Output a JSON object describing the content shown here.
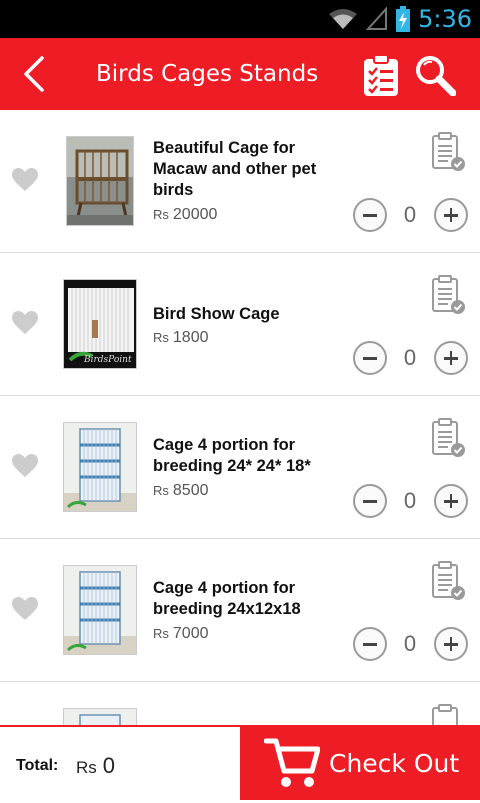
{
  "status_bar": {
    "time": "5:36",
    "icons": [
      "wifi-icon",
      "signal-icon",
      "battery-icon"
    ]
  },
  "app_bar": {
    "title": "Birds Cages Stands",
    "back_icon": "back-arrow-icon",
    "list_icon": "clipboard-list-icon",
    "search_icon": "search-icon"
  },
  "currency_symbol": "Rs",
  "products": [
    {
      "name": "Beautiful Cage for Macaw and other pet birds",
      "price": "20000",
      "qty": "0"
    },
    {
      "name": "Bird Show Cage",
      "price": "1800",
      "qty": "0"
    },
    {
      "name": "Cage 4 portion for breeding 24* 24* 18*",
      "price": "8500",
      "qty": "0"
    },
    {
      "name": "Cage 4 portion for breeding 24x12x18",
      "price": "7000",
      "qty": "0"
    }
  ],
  "footer": {
    "total_label": "Total:",
    "total_value": "0",
    "checkout_label": "Check Out"
  },
  "colors": {
    "brand_red": "#ee1c25",
    "status_blue": "#33b5e5"
  }
}
